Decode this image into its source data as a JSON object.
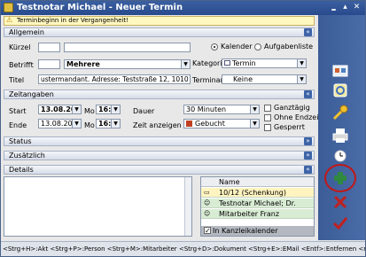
{
  "window": {
    "title": "Testnotar Michael - Neuer Termin",
    "minimize_glyph": "‗",
    "maximize_glyph": "▴",
    "close_glyph": "✕"
  },
  "warning": {
    "text": "Terminbeginn in der Vergangenheit!",
    "icon": "warning-icon"
  },
  "sections": {
    "allgemein": "Allgemein",
    "zeitangaben": "Zeitangaben",
    "status": "Status",
    "zusaetzlich": "Zusätzlich",
    "details": "Details",
    "chevron_up": "«",
    "chevron_down": "»"
  },
  "allgemein": {
    "kuerzel_label": "Kürzel",
    "kuerzel_value": "",
    "kuerzel_long_value": "",
    "betrifft_label": "Betrifft",
    "betrifft_value": "Mehrere",
    "titel_label": "Titel",
    "titel_value": "ustermandant. Adresse: Teststraße 12, 1010 Wien.",
    "radio_kalender": "Kalender",
    "radio_aufgabenliste": "Aufgabenliste",
    "kategorie_label": "Kategorie",
    "kategorie_value": "Termin",
    "terminart_label": "Terminart",
    "terminart_value": "Keine"
  },
  "zeitangaben": {
    "start_label": "Start",
    "start_date": "13.08.2012",
    "start_weekday": "Mo",
    "start_time": "16:00",
    "ende_label": "Ende",
    "ende_date": "13.08.2012",
    "ende_weekday": "Mo",
    "ende_time": "16:30",
    "dauer_label": "Dauer",
    "dauer_value": "30 Minuten",
    "zeit_anzeigen_label": "Zeit anzeigen als",
    "zeit_anzeigen_value": "Gebucht",
    "zeit_anzeigen_color": "#c04020",
    "ganztaegig": "Ganztägig",
    "ohne_endzeit": "Ohne Endzeit",
    "gesperrt": "Gesperrt"
  },
  "details": {
    "notes_text": "",
    "participants_header": "Name",
    "participants": [
      {
        "name": "10/12 (Schenkung)",
        "icon": "folder-icon",
        "color": "#fff4c0"
      },
      {
        "name": "Testnotar Michael; Dr.",
        "icon": "person-icon",
        "color": "#d8ecd4"
      },
      {
        "name": "Mitarbeiter Franz",
        "icon": "person-icon",
        "color": "#d8ecd4"
      }
    ],
    "kanzleikalender_label": "In Kanzleikalender",
    "kanzleikalender_checked": true
  },
  "statusbar": {
    "text": "<Strg+H>:Akt <Strg+P>:Person <Strg+M>:Mitarbeiter <Strg+D>:Dokument <Strg+E>:EMail <Entf>:Entfernen <re. Maus>:Me"
  },
  "toolbar": {
    "tools": [
      "contacts-icon",
      "refresh-icon",
      "key-icon",
      "printer-icon",
      "alarm-clock-icon",
      "add-icon",
      "delete-icon",
      "checkmark-icon"
    ],
    "highlight_color": "#c01818"
  }
}
